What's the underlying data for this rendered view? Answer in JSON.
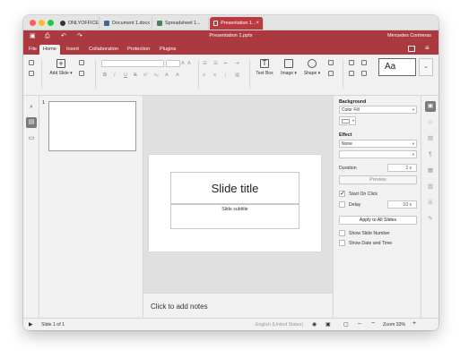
{
  "window": {
    "tabs": [
      {
        "label": "ONLYOFFICE",
        "icon": "onlyoffice-logo-icon"
      },
      {
        "label": "Document 1.docx",
        "icon": "document-icon",
        "color": "#446995"
      },
      {
        "label": "Spreadsheet 1...",
        "icon": "spreadsheet-icon",
        "color": "#40865c"
      },
      {
        "label": "Presentation 1...",
        "icon": "presentation-icon",
        "color": "#aa3a3f",
        "close": "×"
      }
    ]
  },
  "header": {
    "title": "Presentation 1.pptx",
    "user": "Mercedes Contreras",
    "quick_icons": [
      "save-icon",
      "print-icon",
      "undo-icon",
      "redo-icon"
    ]
  },
  "menu": {
    "tabs": [
      "File",
      "Home",
      "Insert",
      "Collaboration",
      "Protection",
      "Plugins"
    ],
    "active": "Home"
  },
  "toolbar": {
    "add_slide": "Add Slide",
    "text_box": "Text Box",
    "image": "Image",
    "shape": "Shape",
    "theme_preview": "Aa"
  },
  "thumbnails": {
    "slide_number": "1"
  },
  "slide": {
    "title": "Slide title",
    "subtitle": "Slide subtitle"
  },
  "notes": {
    "placeholder": "Click to add notes"
  },
  "settings": {
    "background_heading": "Background",
    "fill_value": "Color Fill",
    "effect_heading": "Effect",
    "effect_value": "None",
    "duration_label": "Duration",
    "duration_value": "2 s",
    "preview_label": "Preview",
    "start_on_click": "Start On Click",
    "delay_label": "Delay",
    "delay_value": "10 s",
    "apply_all": "Apply to All Slides",
    "show_slide_number": "Show Slide Number",
    "show_date_time": "Show Date and Time"
  },
  "status": {
    "slide_of": "Slide 1 of 1",
    "language": "English (United States)",
    "zoom": "Zoom 33%"
  },
  "colors": {
    "accent": "#aa3a3f",
    "panel": "#f1f1f1",
    "canvas": "#e0e0e0"
  }
}
